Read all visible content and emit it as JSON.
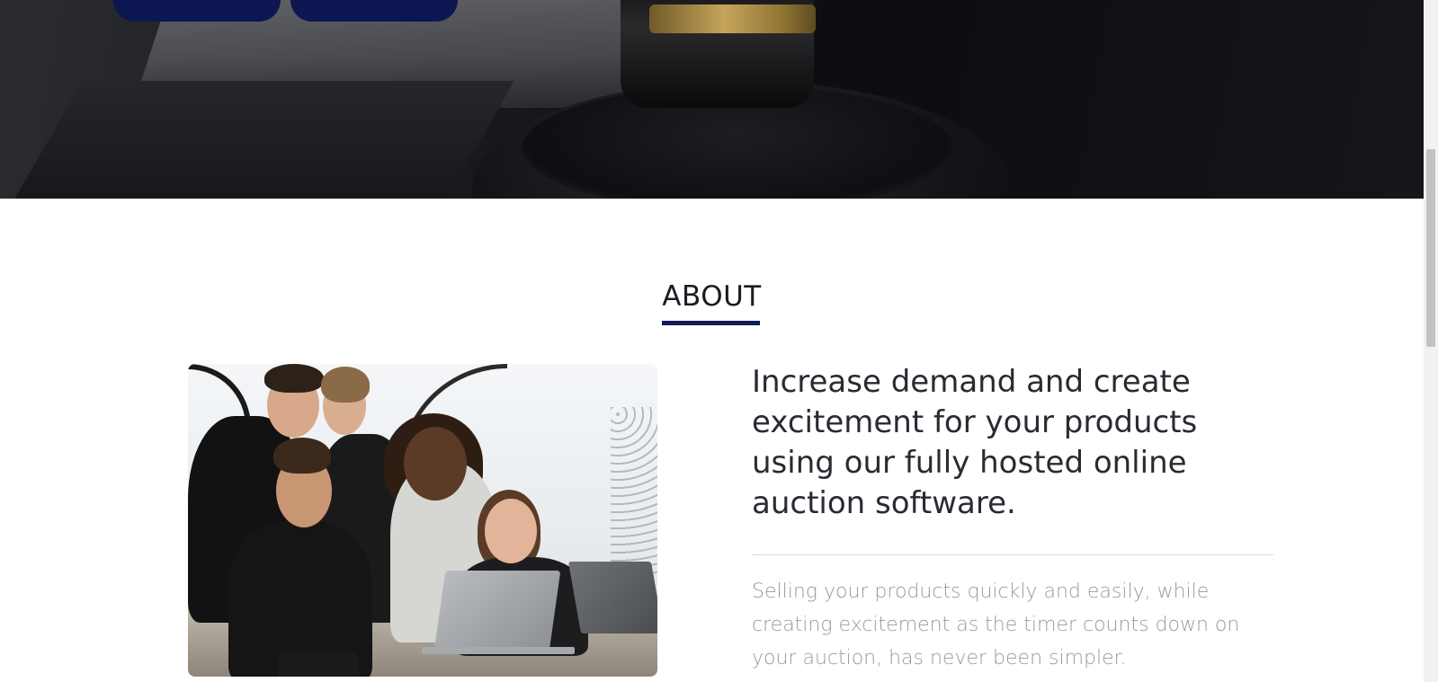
{
  "about": {
    "title": "ABOUT",
    "headline": "Increase demand and create excitement for your products using our fully hosted online auction software.",
    "body": "Selling your products quickly and easily, while creating excitement as the timer counts down on your auction, has never been simpler."
  },
  "colors": {
    "brand_navy": "#101a57",
    "heading": "#2a2a33",
    "muted_text": "#9a9a9e"
  },
  "icons": {
    "hero_image": "gavel-image",
    "about_image": "team-laptop-photo"
  }
}
